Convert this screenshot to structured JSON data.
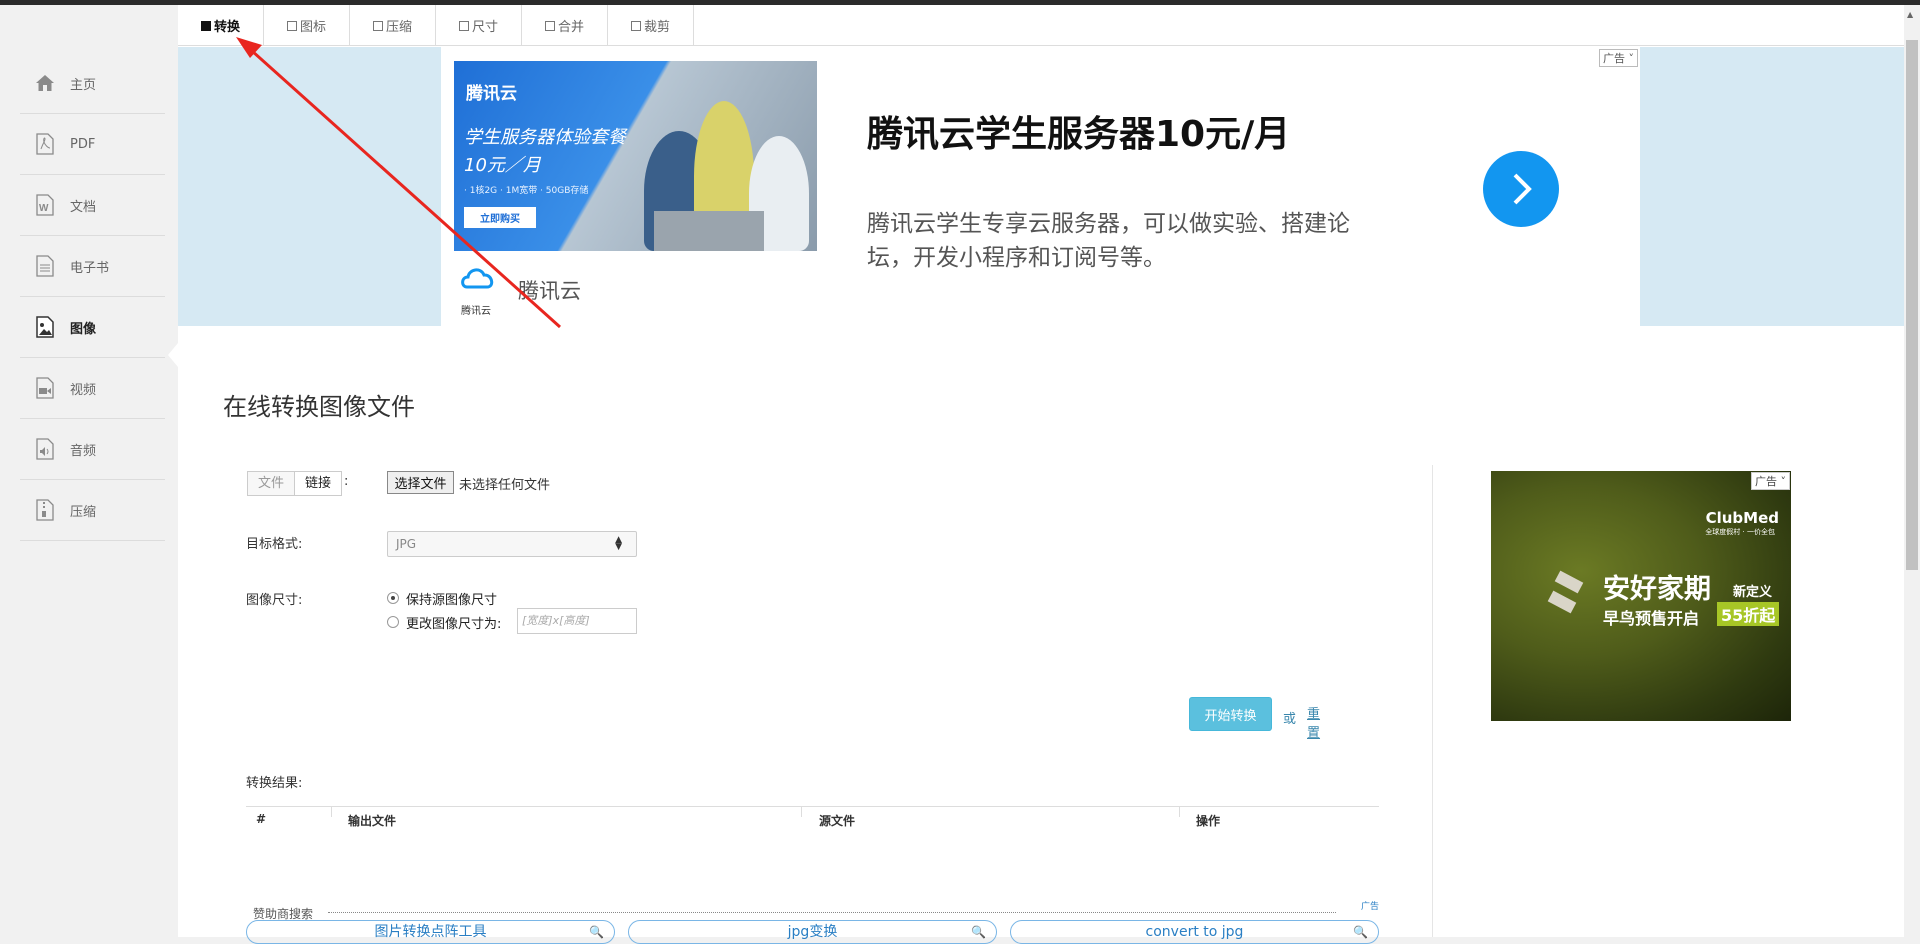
{
  "sidebar": {
    "items": [
      {
        "label": "主页",
        "icon": "home-icon"
      },
      {
        "label": "PDF",
        "icon": "pdf-icon"
      },
      {
        "label": "文档",
        "icon": "word-doc-icon"
      },
      {
        "label": "电子书",
        "icon": "ebook-icon"
      },
      {
        "label": "图像",
        "icon": "image-icon",
        "active": true
      },
      {
        "label": "视频",
        "icon": "video-icon"
      },
      {
        "label": "音频",
        "icon": "audio-icon"
      },
      {
        "label": "压缩",
        "icon": "archive-icon"
      }
    ]
  },
  "tabs": [
    {
      "label": "转换",
      "active": true
    },
    {
      "label": "图标"
    },
    {
      "label": "压缩"
    },
    {
      "label": "尺寸"
    },
    {
      "label": "合并"
    },
    {
      "label": "裁剪"
    }
  ],
  "top_ad": {
    "tag": "广告",
    "image_brand": "腾讯云",
    "image_line1": "学生服务器体验套餐",
    "image_line2": "10元／月",
    "image_specs": "· 1核2G  · 1M宽带  · 50GB存储",
    "image_buy": "立即购买",
    "headline": "腾讯云学生服务器10元/月",
    "description": "腾讯云学生专享云服务器，可以做实验、搭建论坛，开发小程序和订阅号等。",
    "logo_text": "腾讯云",
    "brand_name": "腾讯云",
    "arrow_icon": "chevron-right-icon",
    "accent_color": "#1296f0"
  },
  "page_title": "在线转换图像文件",
  "form": {
    "source_file": "文件",
    "source_link": "链接",
    "colon": ":",
    "choose_button": "选择文件",
    "no_file": "未选择任何文件",
    "target_label": "目标格式:",
    "target_value": "JPG",
    "size_label": "图像尺寸:",
    "keep_size": "保持源图像尺寸",
    "change_size": "更改图像尺寸为:",
    "size_placeholder": "[宽度]x[高度]",
    "convert_button": "开始转换",
    "or": "或",
    "reset": "重置"
  },
  "results": {
    "label": "转换结果:",
    "columns": [
      "#",
      "输出文件",
      "源文件",
      "操作"
    ]
  },
  "sponsor": {
    "label": "赞助商搜索",
    "ad_tag": "广告",
    "pills": [
      "图片转换点阵工具",
      "jpg变换",
      "convert to jpg"
    ]
  },
  "side_ad": {
    "tag": "广告",
    "logo": "ClubMed",
    "logo_sub": "全球度假村 · 一价全包",
    "headline": "安好家期",
    "headline_suffix": "新定义",
    "line2": "早鸟预售开启",
    "discount": "55折起"
  }
}
